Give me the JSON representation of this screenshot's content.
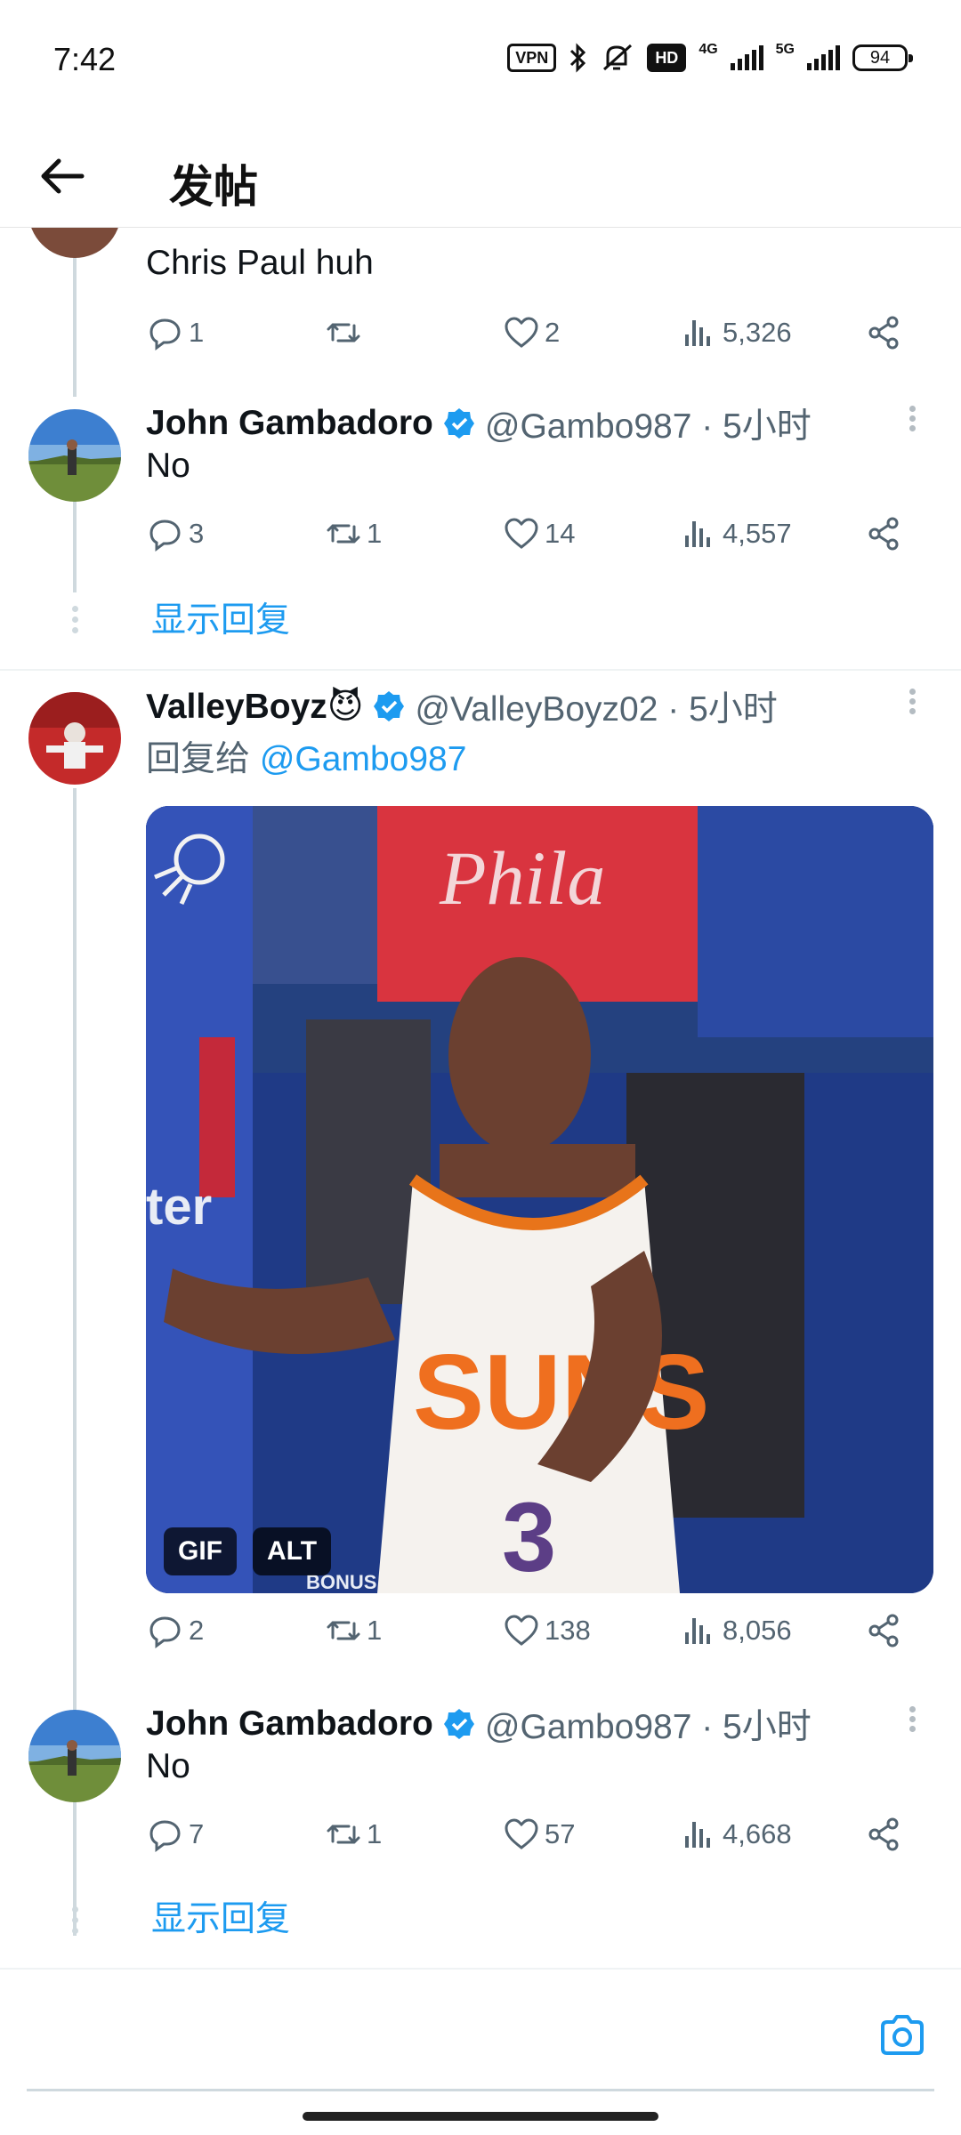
{
  "status_bar": {
    "time": "7:42",
    "vpn": "VPN",
    "hd": "HD",
    "net1": "4G",
    "net2": "5G",
    "battery": "94"
  },
  "header": {
    "title": "发帖"
  },
  "posts": [
    {
      "text": "Chris Paul huh",
      "stats": {
        "replies": "1",
        "reposts": "",
        "likes": "2",
        "views": "5,326"
      }
    },
    {
      "author": "John Gambadoro",
      "handle": "@Gambo987 · 5小时",
      "text": "No",
      "stats": {
        "replies": "3",
        "reposts": "1",
        "likes": "14",
        "views": "4,557"
      }
    },
    {
      "author": "ValleyBoyz😈",
      "handle": "@ValleyBoyz02 · 5小时",
      "reply_prefix": "回复给 ",
      "reply_to": "@Gambo987",
      "media_badges": [
        "GIF",
        "ALT"
      ],
      "media_texts": {
        "team_shirt": "Phila",
        "jersey": "SUNS",
        "number": "3",
        "courtside": "ter",
        "board": "BONUS"
      },
      "stats": {
        "replies": "2",
        "reposts": "1",
        "likes": "138",
        "views": "8,056"
      }
    },
    {
      "author": "John Gambadoro",
      "handle": "@Gambo987 · 5小时",
      "text": "No",
      "stats": {
        "replies": "7",
        "reposts": "1",
        "likes": "57",
        "views": "4,668"
      }
    }
  ],
  "show_replies_label": "显示回复",
  "composer": {
    "placeholder": ""
  },
  "colors": {
    "accent": "#1d9bf0",
    "secondary_text": "#536471",
    "thread_line": "#cfd9de"
  },
  "icons": [
    "back-arrow-icon",
    "verified-badge-icon",
    "more-icon",
    "reply-icon",
    "repost-icon",
    "like-icon",
    "views-icon",
    "share-icon",
    "camera-icon"
  ]
}
